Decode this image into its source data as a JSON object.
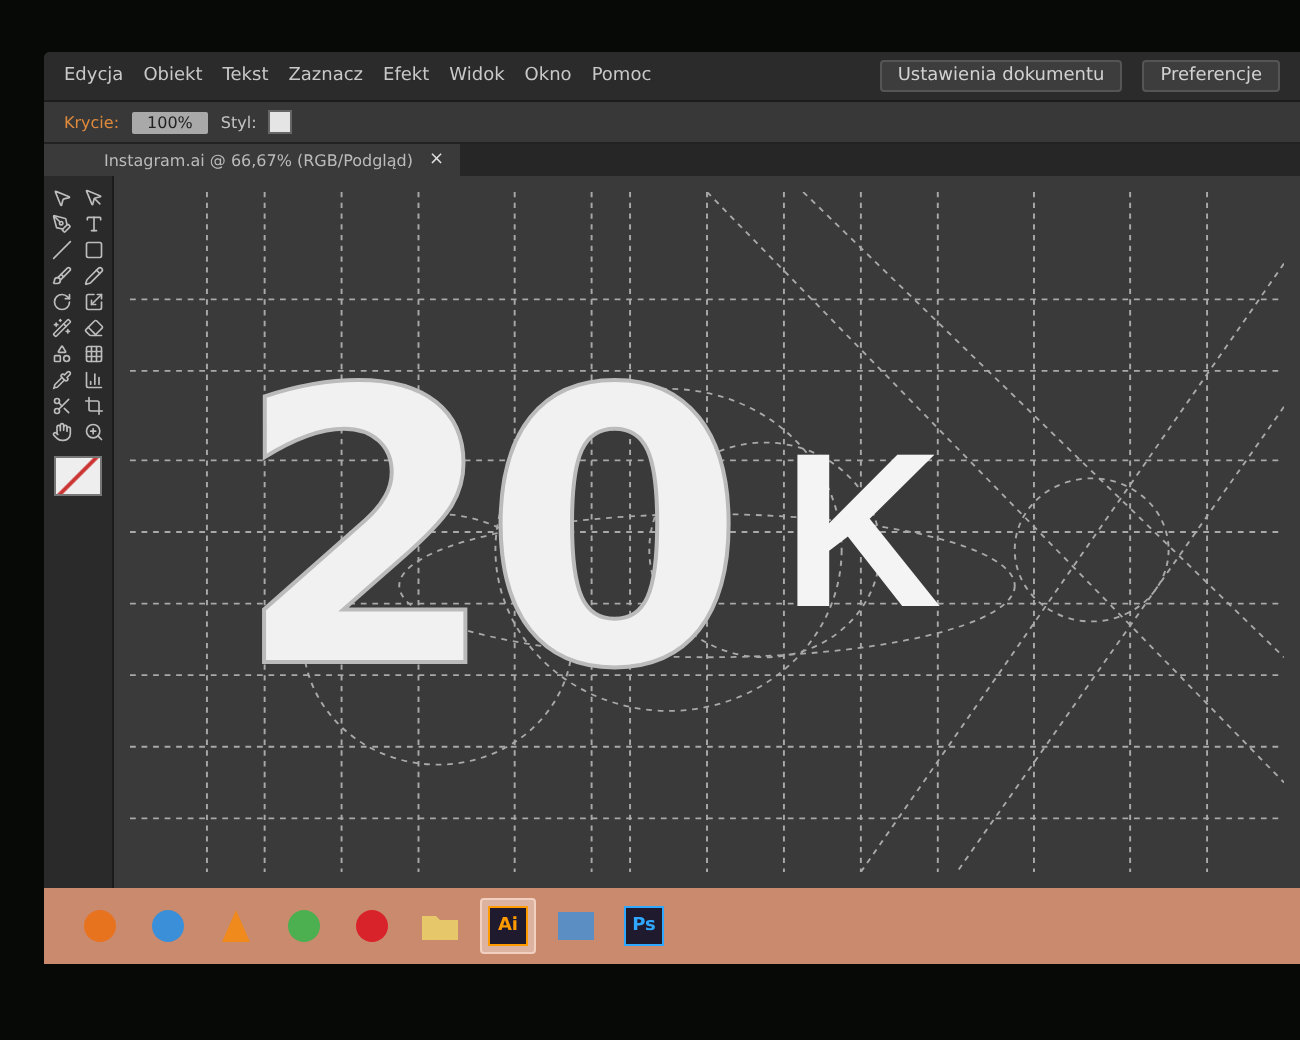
{
  "menu_bar": {
    "items": [
      "Edycja",
      "Obiekt",
      "Tekst",
      "Zaznacz",
      "Efekt",
      "Widok",
      "Okno",
      "Pomoc"
    ],
    "buttons": [
      "Ustawienia dokumentu",
      "Preferencje"
    ]
  },
  "control_bar": {
    "opacity_label": "Krycie:",
    "opacity_value": "100%",
    "style_label": "Styl:"
  },
  "document_tab": {
    "title": "Instagram.ai @ 66,67% (RGB/Podgląd)",
    "close": "×"
  },
  "artwork": {
    "digits": "20",
    "letter": "K"
  },
  "taskbar": {
    "apps": [
      {
        "kind": "round",
        "color": "#e8731f",
        "selected": false
      },
      {
        "kind": "round",
        "color": "#3a8fd8",
        "selected": false
      },
      {
        "kind": "cone",
        "color": "#f08a1c",
        "selected": false
      },
      {
        "kind": "round",
        "color": "#4caf50",
        "selected": false
      },
      {
        "kind": "round",
        "color": "#d8232a",
        "selected": false
      },
      {
        "kind": "folder",
        "color": "#e6c86a",
        "selected": false
      },
      {
        "kind": "badge",
        "label": "Ai",
        "color": "#ff9a00",
        "selected": true
      },
      {
        "kind": "photo",
        "color": "#5b8fc4",
        "selected": false
      },
      {
        "kind": "badge",
        "label": "Ps",
        "color": "#31a8ff",
        "selected": false
      }
    ]
  }
}
